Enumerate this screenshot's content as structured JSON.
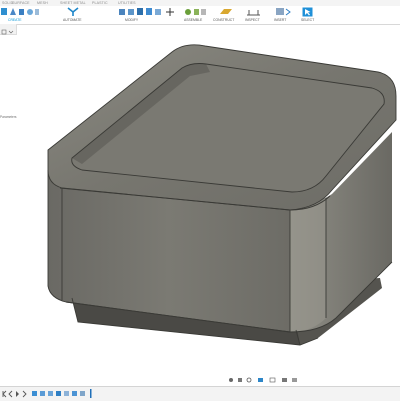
{
  "ribbon_tabs": [
    "SOLID",
    "SURFACE",
    "MESH",
    "SHEET METAL",
    "PLASTIC",
    "UTILITIES"
  ],
  "ribbon_groups": {
    "create": "CREATE",
    "automate": "AUTOMATE",
    "modify": "MODIFY",
    "assemble": "ASSEMBLE",
    "construct": "CONSTRUCT",
    "inspect": "INSPECT",
    "insert": "INSERT",
    "select": "SELECT"
  },
  "browser_hint": "Parameters",
  "colors": {
    "accent": "#0696d7",
    "model_top": "#7c7b74",
    "model_side": "#6f6e68",
    "model_edge": "#3e3e3a"
  },
  "icons": [
    "new-component-icon",
    "sketch-icon",
    "extrude-icon",
    "revolve-icon",
    "automate-icon",
    "press-pull-icon",
    "fillet-icon",
    "move-icon",
    "joint-icon",
    "plane-icon",
    "measure-icon",
    "insert-icon",
    "select-icon",
    "orbit-icon",
    "pan-icon",
    "zoom-icon",
    "display-settings-icon",
    "grid-icon"
  ]
}
